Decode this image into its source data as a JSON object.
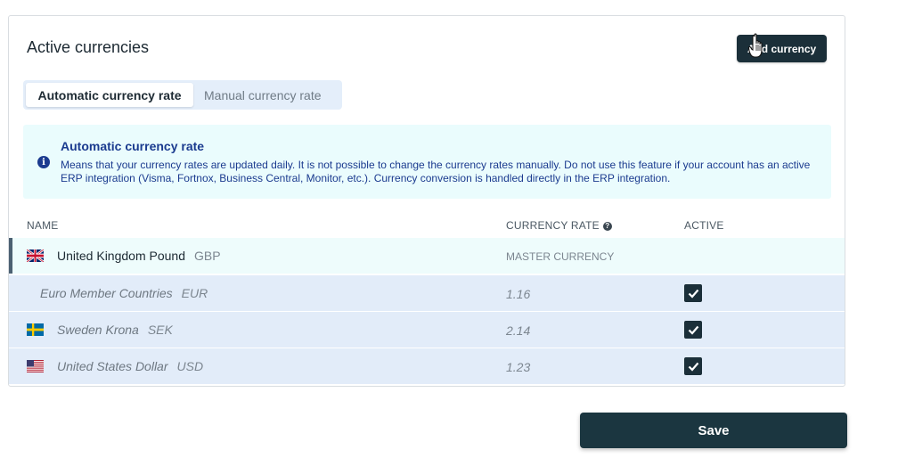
{
  "card": {
    "title": "Active currencies",
    "add_button_label": "Add currency"
  },
  "tabs": [
    {
      "label": "Automatic currency rate",
      "active": true
    },
    {
      "label": "Manual currency rate",
      "active": false
    }
  ],
  "info": {
    "title": "Automatic currency rate",
    "text": "Means that your currency rates are updated daily. It is not possible to change the currency rates manually. Do not use this feature if your account has an active ERP integration (Visma, Fortnox, Business Central, Monitor, etc.). Currency conversion is handled directly in the ERP integration.",
    "icon": "info-icon"
  },
  "table": {
    "headers": {
      "name": "NAME",
      "rate": "CURRENCY RATE",
      "active": "ACTIVE"
    },
    "rows": [
      {
        "name": "United Kingdom Pound",
        "code": "GBP",
        "rate": "MASTER CURRENCY",
        "flag": "uk-flag-icon",
        "master": true
      },
      {
        "name": "Euro Member Countries",
        "code": "EUR",
        "rate": "1.16",
        "flag": "",
        "active": true
      },
      {
        "name": "Sweden Krona",
        "code": "SEK",
        "rate": "2.14",
        "flag": "sweden-flag-icon",
        "active": true
      },
      {
        "name": "United States Dollar",
        "code": "USD",
        "rate": "1.23",
        "flag": "us-flag-icon",
        "active": true
      }
    ]
  },
  "footer": {
    "save_label": "Save"
  },
  "colors": {
    "primary": "#1b2f39",
    "info_bg": "#eafcfd",
    "info_text": "#1b3b8f",
    "row_bg": "#e2ecf9"
  }
}
